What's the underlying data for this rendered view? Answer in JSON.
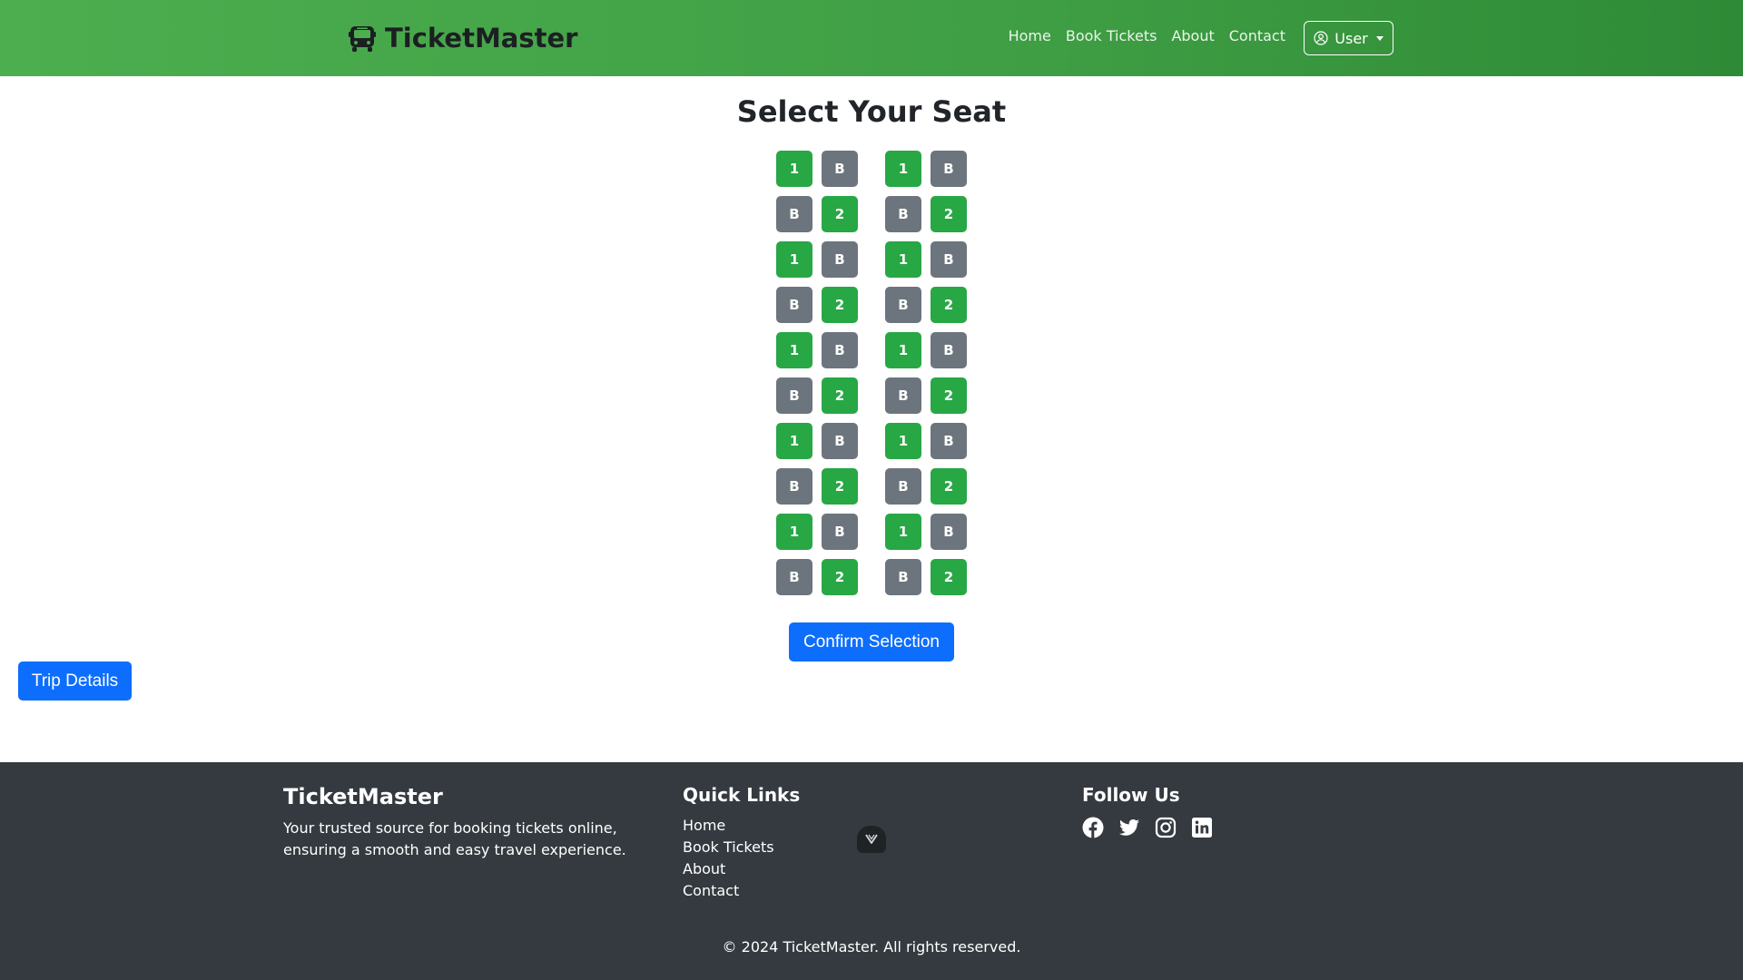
{
  "navbar": {
    "brand": "TicketMaster",
    "links": [
      "Home",
      "Book Tickets",
      "About",
      "Contact"
    ],
    "user_label": "User"
  },
  "main": {
    "title": "Select Your Seat",
    "seat_rows": [
      [
        "1",
        "B",
        "1",
        "B"
      ],
      [
        "B",
        "2",
        "B",
        "2"
      ],
      [
        "1",
        "B",
        "1",
        "B"
      ],
      [
        "B",
        "2",
        "B",
        "2"
      ],
      [
        "1",
        "B",
        "1",
        "B"
      ],
      [
        "B",
        "2",
        "B",
        "2"
      ],
      [
        "1",
        "B",
        "1",
        "B"
      ],
      [
        "B",
        "2",
        "B",
        "2"
      ],
      [
        "1",
        "B",
        "1",
        "B"
      ],
      [
        "B",
        "2",
        "B",
        "2"
      ]
    ],
    "confirm_label": "Confirm Selection",
    "trip_details_label": "Trip Details"
  },
  "footer": {
    "brand": "TicketMaster",
    "description": "Your trusted source for booking tickets online, ensuring a smooth and easy travel experience.",
    "quick_links_heading": "Quick Links",
    "quick_links": [
      "Home",
      "Book Tickets",
      "About",
      "Contact"
    ],
    "follow_heading": "Follow Us",
    "socials": [
      "facebook-icon",
      "twitter-icon",
      "instagram-icon",
      "linkedin-icon"
    ],
    "copyright": "© 2024 TicketMaster. All rights reserved."
  },
  "colors": {
    "seat_available": "#28a745",
    "seat_booked": "#6c757d",
    "primary": "#0d6efd",
    "nav_green": "#43a047",
    "footer_bg": "#343a40"
  }
}
